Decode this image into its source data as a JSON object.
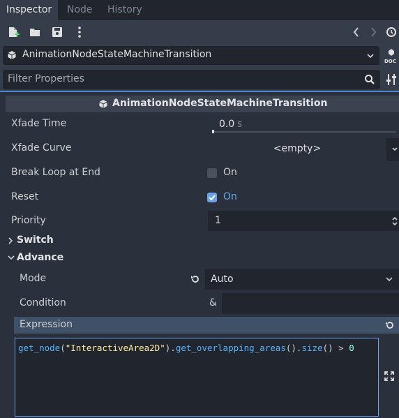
{
  "tabs": [
    {
      "label": "Inspector"
    },
    {
      "label": "Node"
    },
    {
      "label": "History"
    }
  ],
  "resource": {
    "name": "AnimationNodeStateMachineTransition"
  },
  "filter": {
    "placeholder": "Filter Properties"
  },
  "section_title": "AnimationNodeStateMachineTransition",
  "properties": {
    "xfade_time": {
      "label": "Xfade Time",
      "value": "0.0",
      "unit": "s"
    },
    "xfade_curve": {
      "label": "Xfade Curve",
      "value": "<empty>"
    },
    "break_loop": {
      "label": "Break Loop at End",
      "value": "On",
      "checked": false
    },
    "reset": {
      "label": "Reset",
      "value": "On",
      "checked": true
    },
    "priority": {
      "label": "Priority",
      "value": "1"
    }
  },
  "groups": {
    "switch": "Switch",
    "advance": "Advance"
  },
  "advance": {
    "mode": {
      "label": "Mode",
      "value": "Auto"
    },
    "condition": {
      "label": "Condition",
      "prefix": "&",
      "value": ""
    },
    "expression": {
      "label": "Expression"
    }
  },
  "code": {
    "func1": "get_node",
    "p1": "(",
    "str": "\"InteractiveArea2D\"",
    "p2": ").",
    "func2": "get_overlapping_areas",
    "p3": "().",
    "func3": "size",
    "p4": "() > ",
    "num": "0"
  },
  "colors": {
    "accent": "#4e88d1",
    "code_function": "#57b3ff",
    "code_string": "#ffeda1",
    "code_number": "#a1ffe0",
    "checkbox_checked": "#6aa3e6"
  }
}
